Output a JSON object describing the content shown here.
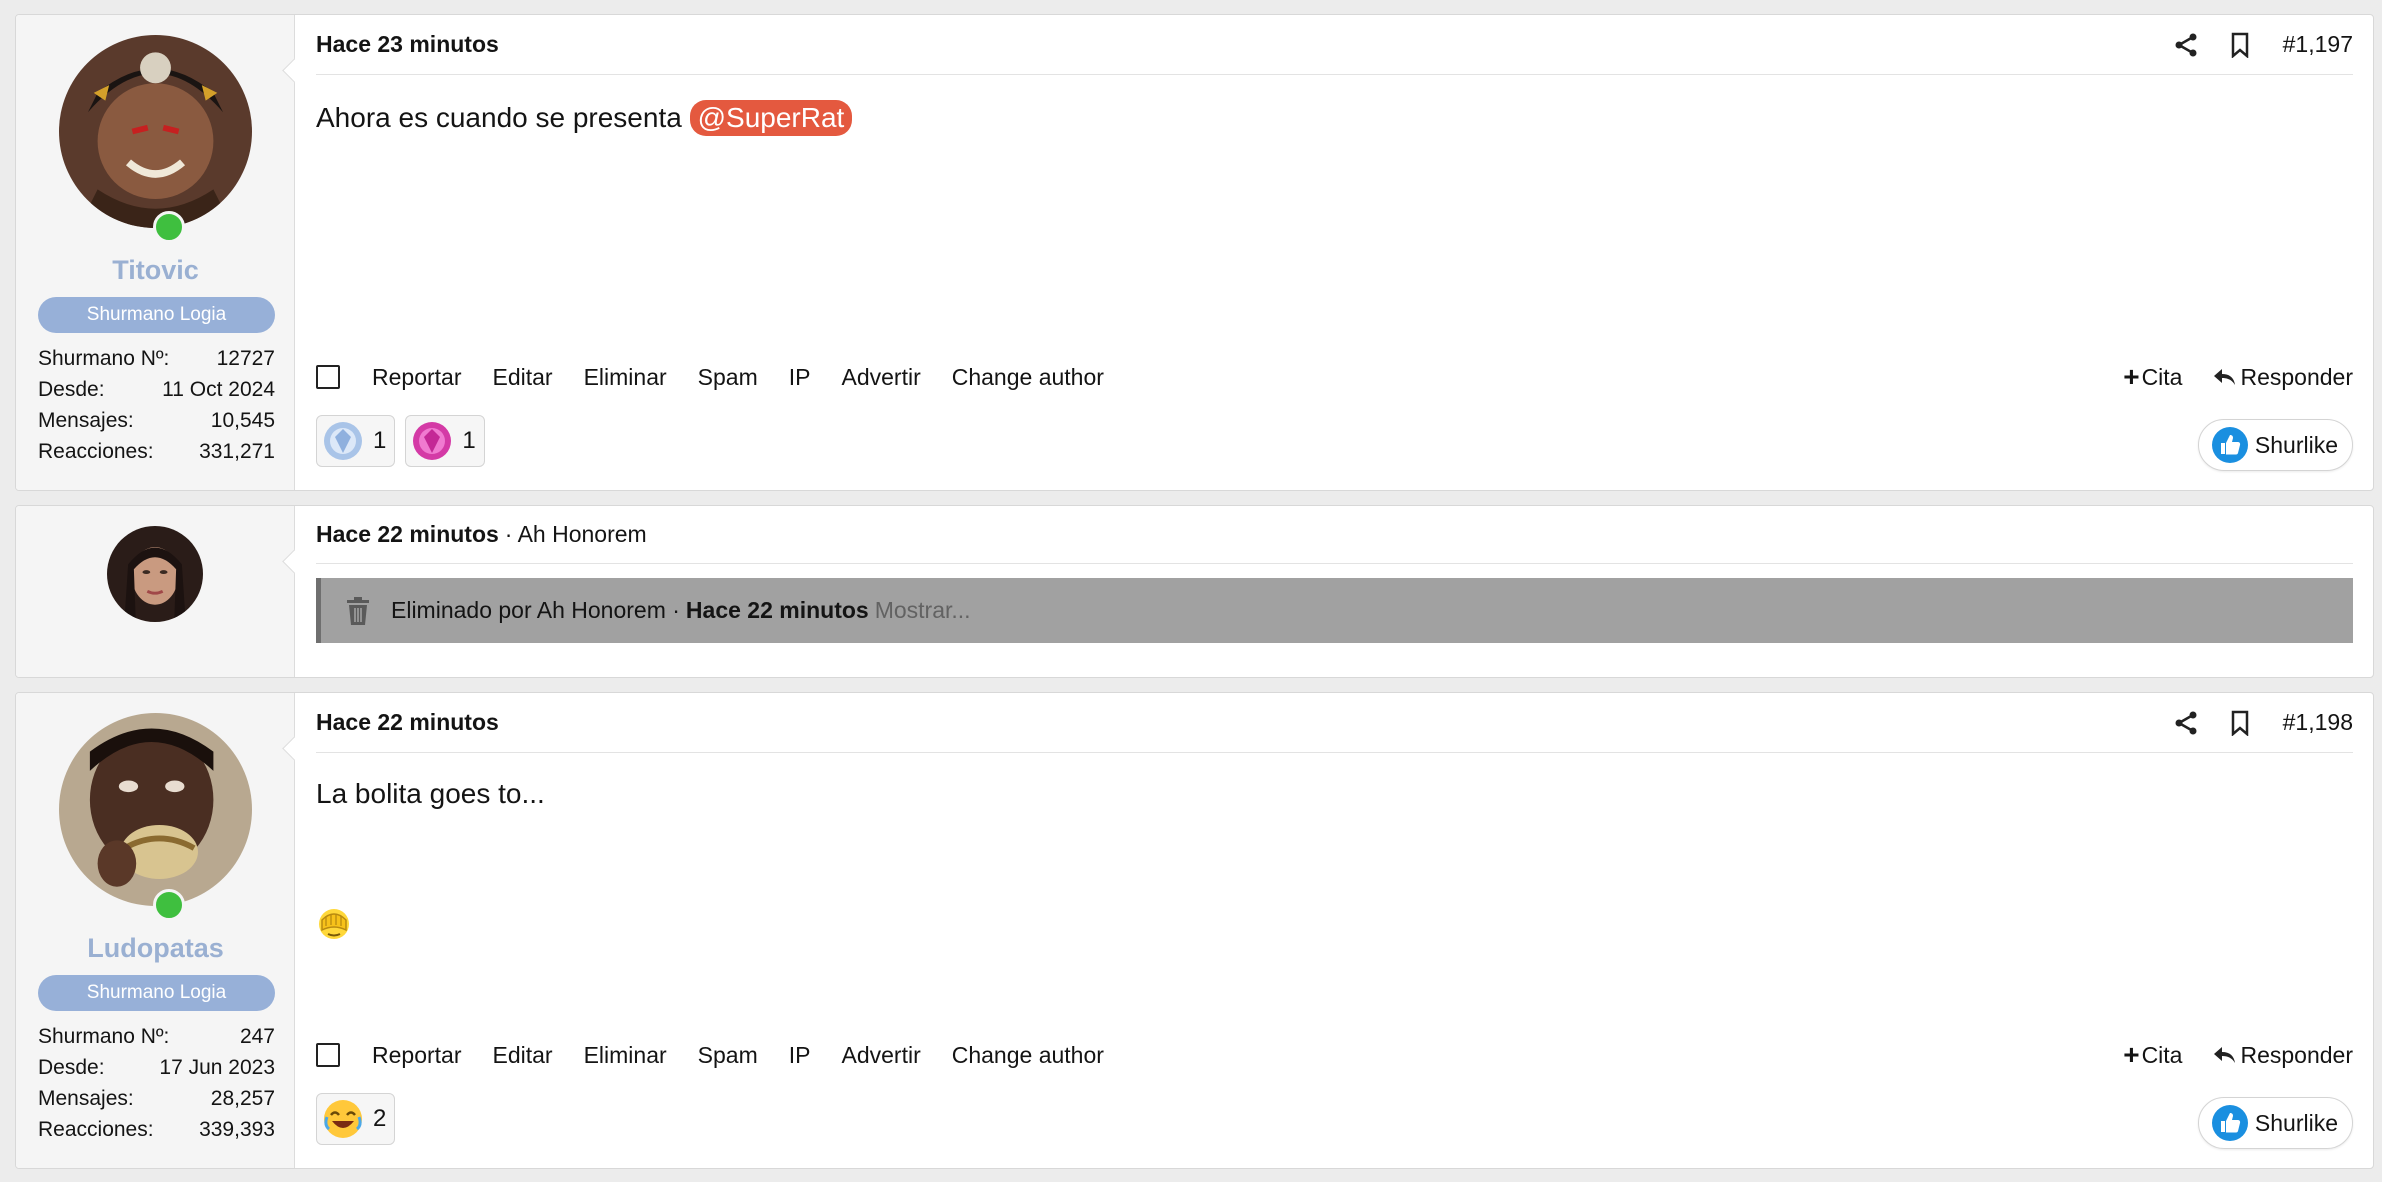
{
  "colors": {
    "username": "#9ab0d2",
    "role_badge": "#97b0d8",
    "mention": "#e4593f",
    "online": "#3fbf3f",
    "deleted_bar": "#a1a1a1"
  },
  "posts": [
    {
      "time": "Hace 23 minutos",
      "number": "#1,197",
      "user": {
        "name": "Titovic",
        "role": "Shurmano Logia",
        "stats": [
          {
            "label": "Shurmano Nº:",
            "value": "12727"
          },
          {
            "label": "Desde:",
            "value": "11 Oct 2024"
          },
          {
            "label": "Mensajes:",
            "value": "10,545"
          },
          {
            "label": "Reacciones:",
            "value": "331,271"
          }
        ]
      },
      "body_text": "Ahora es cuando se presenta",
      "mention": "@SuperRat",
      "reactions": [
        {
          "icon": "blue-gem-icon",
          "count": "1"
        },
        {
          "icon": "pink-gem-icon",
          "count": "1"
        }
      ]
    },
    {
      "time": "Hace 22 minutos",
      "author": "· Ah Honorem",
      "deleted": {
        "text": "Eliminado por Ah Honorem ·",
        "time": "Hace 22 minutos",
        "show": "Mostrar..."
      }
    },
    {
      "time": "Hace 22 minutos",
      "number": "#1,198",
      "user": {
        "name": "Ludopatas",
        "role": "Shurmano Logia",
        "stats": [
          {
            "label": "Shurmano Nº:",
            "value": "247"
          },
          {
            "label": "Desde:",
            "value": "17 Jun 2023"
          },
          {
            "label": "Mensajes:",
            "value": "28,257"
          },
          {
            "label": "Reacciones:",
            "value": "339,393"
          }
        ]
      },
      "body_text": "La bolita goes to...",
      "body_emoji": "facepalm-emoji-icon",
      "reactions": [
        {
          "icon": "laughing-emoji-icon",
          "count": "2"
        }
      ]
    }
  ],
  "actions": {
    "report": "Reportar",
    "edit": "Editar",
    "delete": "Eliminar",
    "spam": "Spam",
    "ip": "IP",
    "warn": "Advertir",
    "change_author": "Change author",
    "quote": "Cita",
    "reply": "Responder",
    "like": "Shurlike"
  }
}
